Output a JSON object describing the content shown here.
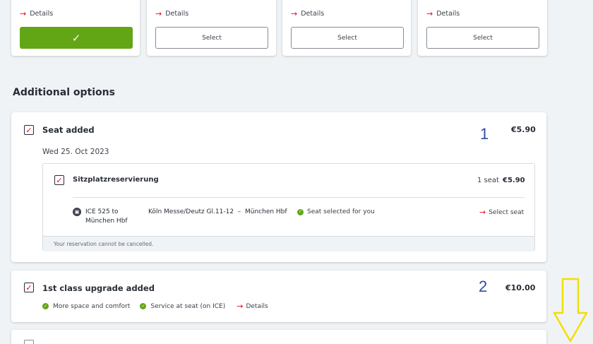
{
  "fares": [
    {
      "details": "Details",
      "selected": true
    },
    {
      "details": "Details",
      "button": "Select",
      "selected": false
    },
    {
      "details": "Details",
      "button": "Select",
      "selected": false
    },
    {
      "details": "Details",
      "button": "Select",
      "selected": false
    }
  ],
  "additional_options": {
    "title": "Additional options"
  },
  "seat": {
    "title": "Seat added",
    "annotation": "1",
    "price": "€5.90",
    "date": "Wed 25. Oct 2023",
    "reservation": {
      "title": "Sitzplatzreservierung",
      "count": "1 seat",
      "price": "€5.90",
      "train_line1": "ICE 525 to",
      "train_line2": "München Hbf",
      "route": "Köln Messe/Deutz Gl.11-12  –  München Hbf",
      "status": "Seat selected for you",
      "select_seat": "Select seat",
      "note": "Your reservation cannot be cancelled."
    }
  },
  "upgrade": {
    "title": "1st class upgrade added",
    "annotation": "2",
    "price": "€10.00",
    "features": [
      "More space and comfort",
      "Service at seat (on ICE)"
    ],
    "details": "Details"
  },
  "colors": {
    "accent_red": "#ec0016",
    "green": "#63a615",
    "annotation_blue": "#2b4fa0",
    "arrow_yellow": "#f0e000"
  },
  "icons": {
    "link_arrow": "arrow-right-icon",
    "check": "checkmark-icon",
    "train": "train-icon",
    "down_arrow": "down-arrow-annotation-icon"
  }
}
